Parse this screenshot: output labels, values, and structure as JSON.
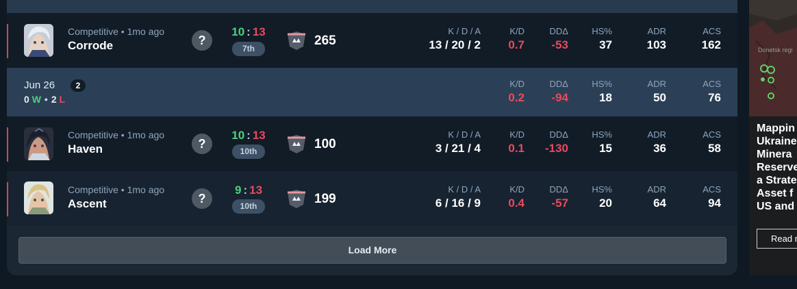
{
  "matches": [
    {
      "mode": "Competitive • 1mo ago",
      "map": "Corrode",
      "won": "10",
      "lost": "13",
      "placement": "7th",
      "rr": "265",
      "stats": {
        "kda_label": "K / D / A",
        "kda": "13 / 20 / 2",
        "kd_label": "K/D",
        "kd": "0.7",
        "dd_label": "DDΔ",
        "dd": "-53",
        "hs_label": "HS%",
        "hs": "37",
        "adr_label": "ADR",
        "adr": "103",
        "acs_label": "ACS",
        "acs": "162"
      }
    },
    {
      "mode": "Competitive • 1mo ago",
      "map": "Haven",
      "won": "10",
      "lost": "13",
      "placement": "10th",
      "rr": "100",
      "stats": {
        "kda_label": "K / D / A",
        "kda": "3 / 21 / 4",
        "kd_label": "K/D",
        "kd": "0.1",
        "dd_label": "DDΔ",
        "dd": "-130",
        "hs_label": "HS%",
        "hs": "15",
        "adr_label": "ADR",
        "adr": "36",
        "acs_label": "ACS",
        "acs": "58"
      }
    },
    {
      "mode": "Competitive • 1mo ago",
      "map": "Ascent",
      "won": "9",
      "lost": "13",
      "placement": "10th",
      "rr": "199",
      "stats": {
        "kda_label": "K / D / A",
        "kda": "6 / 16 / 9",
        "kd_label": "K/D",
        "kd": "0.4",
        "dd_label": "DDΔ",
        "dd": "-57",
        "hs_label": "HS%",
        "hs": "20",
        "adr_label": "ADR",
        "adr": "64",
        "acs_label": "ACS",
        "acs": "94"
      }
    }
  ],
  "day": {
    "date": "Jun 26",
    "count": "2",
    "wins": "0",
    "w_letter": "W",
    "dot": "•",
    "losses": "2",
    "l_letter": "L",
    "stats": {
      "kd_label": "K/D",
      "kd": "0.2",
      "dd_label": "DDΔ",
      "dd": "-94",
      "hs_label": "HS%",
      "hs": "18",
      "adr_label": "ADR",
      "adr": "50",
      "acs_label": "ACS",
      "acs": "76"
    }
  },
  "question_mark": "?",
  "score_separator": ":",
  "load_more": "Load More",
  "ad": {
    "location": "Donetsk regi",
    "title_lines": [
      "Mappin",
      "Ukraine",
      "Minera",
      "Reserve",
      "a Strate",
      "Asset f",
      "US and"
    ],
    "button": "Read m"
  },
  "colors": {
    "win": "#4bd37f",
    "loss": "#e94a5e",
    "accent_bar": "#d74556"
  },
  "icons": {
    "help": "question-icon",
    "rank": "rank-icon"
  }
}
